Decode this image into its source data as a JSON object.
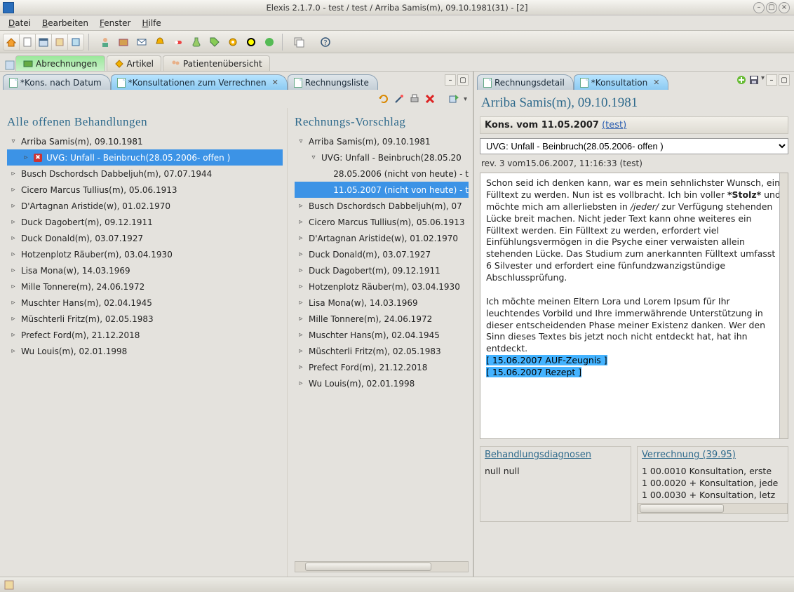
{
  "window": {
    "title": "Elexis 2.1.7.0 -  test / test  / Arriba Samis(m), 09.10.1981(31) - [2]"
  },
  "menubar": [
    "Datei",
    "Bearbeiten",
    "Fenster",
    "Hilfe"
  ],
  "perspective_tabs": [
    {
      "label": "Abrechnungen",
      "active": true
    },
    {
      "label": "Artikel",
      "active": false
    },
    {
      "label": "Patientenübersicht",
      "active": false
    }
  ],
  "left": {
    "tabs": [
      {
        "label": "*Kons. nach Datum"
      },
      {
        "label": "*Konsultationen zum Verrechnen",
        "selected": true,
        "closable": true
      },
      {
        "label": "Rechnungsliste"
      }
    ],
    "panel1": {
      "title": "Alle offenen Behandlungen",
      "rows": [
        {
          "lvl": 1,
          "tw": "▿",
          "text": "Arriba Samis(m), 09.10.1981"
        },
        {
          "lvl": 2,
          "tw": "▹",
          "sel": true,
          "err": true,
          "text": "UVG: Unfall - Beinbruch(28.05.2006- offen )"
        },
        {
          "lvl": 1,
          "tw": "▹",
          "text": "Busch Dschordsch Dabbeljuh(m), 07.07.1944"
        },
        {
          "lvl": 1,
          "tw": "▹",
          "text": "Cicero Marcus Tullius(m), 05.06.1913"
        },
        {
          "lvl": 1,
          "tw": "▹",
          "text": "D'Artagnan Aristide(w), 01.02.1970"
        },
        {
          "lvl": 1,
          "tw": "▹",
          "text": "Duck Dagobert(m), 09.12.1911"
        },
        {
          "lvl": 1,
          "tw": "▹",
          "text": "Duck Donald(m), 03.07.1927"
        },
        {
          "lvl": 1,
          "tw": "▹",
          "text": "Hotzenplotz Räuber(m), 03.04.1930"
        },
        {
          "lvl": 1,
          "tw": "▹",
          "text": "Lisa Mona(w), 14.03.1969"
        },
        {
          "lvl": 1,
          "tw": "▹",
          "text": "Mille Tonnere(m), 24.06.1972"
        },
        {
          "lvl": 1,
          "tw": "▹",
          "text": "Muschter Hans(m), 02.04.1945"
        },
        {
          "lvl": 1,
          "tw": "▹",
          "text": "Müschterli Fritz(m), 02.05.1983"
        },
        {
          "lvl": 1,
          "tw": "▹",
          "text": "Prefect Ford(m), 21.12.2018"
        },
        {
          "lvl": 1,
          "tw": "▹",
          "text": "Wu Louis(m), 02.01.1998"
        }
      ]
    },
    "panel2": {
      "title": "Rechnungs-Vorschlag",
      "rows": [
        {
          "lvl": 1,
          "tw": "▿",
          "text": "Arriba Samis(m), 09.10.1981"
        },
        {
          "lvl": 2,
          "tw": "▿",
          "text": "UVG: Unfall - Beinbruch(28.05.20"
        },
        {
          "lvl": 3,
          "tw": "",
          "text": "28.05.2006 (nicht von heute) - t"
        },
        {
          "lvl": 3,
          "tw": "",
          "sel": true,
          "text": "11.05.2007 (nicht von heute) - t"
        },
        {
          "lvl": 1,
          "tw": "▹",
          "text": "Busch Dschordsch Dabbeljuh(m), 07"
        },
        {
          "lvl": 1,
          "tw": "▹",
          "text": "Cicero Marcus Tullius(m), 05.06.1913"
        },
        {
          "lvl": 1,
          "tw": "▹",
          "text": "D'Artagnan Aristide(w), 01.02.1970"
        },
        {
          "lvl": 1,
          "tw": "▹",
          "text": "Duck Donald(m), 03.07.1927"
        },
        {
          "lvl": 1,
          "tw": "▹",
          "text": "Duck Dagobert(m), 09.12.1911"
        },
        {
          "lvl": 1,
          "tw": "▹",
          "text": "Hotzenplotz Räuber(m), 03.04.1930"
        },
        {
          "lvl": 1,
          "tw": "▹",
          "text": "Lisa Mona(w), 14.03.1969"
        },
        {
          "lvl": 1,
          "tw": "▹",
          "text": "Mille Tonnere(m), 24.06.1972"
        },
        {
          "lvl": 1,
          "tw": "▹",
          "text": "Muschter Hans(m), 02.04.1945"
        },
        {
          "lvl": 1,
          "tw": "▹",
          "text": "Müschterli Fritz(m), 02.05.1983"
        },
        {
          "lvl": 1,
          "tw": "▹",
          "text": "Prefect Ford(m), 21.12.2018"
        },
        {
          "lvl": 1,
          "tw": "▹",
          "text": "Wu Louis(m), 02.01.1998"
        }
      ]
    }
  },
  "right": {
    "tabs": [
      {
        "label": "Rechnungsdetail"
      },
      {
        "label": "*Konsultation",
        "selected": true,
        "closable": true
      }
    ],
    "header": "Arriba Samis(m), 09.10.1981",
    "sub_label": "Kons. vom 11.05.2007",
    "sub_link": "(test)",
    "dropdown_value": "UVG: Unfall - Beinbruch(28.05.2006- offen )",
    "rev_line": "rev. 3 vom15.06.2007, 11:16:33 (test)",
    "text_body_pre": "Schon seid ich denken kann, war es mein sehnlichster Wunsch, ein Fülltext zu werden. Nun ist es vollbracht. Ich bin voller ",
    "text_body_bold": "*Stolz*",
    "text_body_mid": " und möchte mich am allerliebsten in ",
    "text_body_ital": "/jeder/",
    "text_body_post": " zur Verfügung stehenden Lücke breit machen. Nicht jeder Text kann ohne weiteres ein Fülltext werden. Ein Fülltext zu werden, erfordert viel Einfühlungsvermögen in die Psyche einer verwaisten allein stehenden Lücke. Das Studium zum anerkannten Fülltext umfasst 6 Silvester und erfordert eine fünfundzwanzigstündige Abschlussprüfung.",
    "text_body_para2": "Ich möchte meinen Eltern Lora und Lorem Ipsum für Ihr leuchtendes Vorbild und Ihre immerwährende Unterstützung in dieser entscheidenden Phase meiner Existenz danken. Wer den Sinn dieses Textes bis jetzt noch nicht entdeckt hat, hat ihn entdeckt.",
    "highlight1": "[ 15.06.2007 AUF-Zeugnis ]",
    "highlight2": "[ 15.06.2007 Rezept ]",
    "diag_header": "Behandlungsdiagnosen",
    "diag_body": "null null",
    "verr_header": "Verrechnung (39.95)",
    "verr_items": [
      "1 00.0010 Konsultation, erste",
      "1 00.0020 + Konsultation, jede",
      "1 00.0030 + Konsultation, letz"
    ]
  }
}
